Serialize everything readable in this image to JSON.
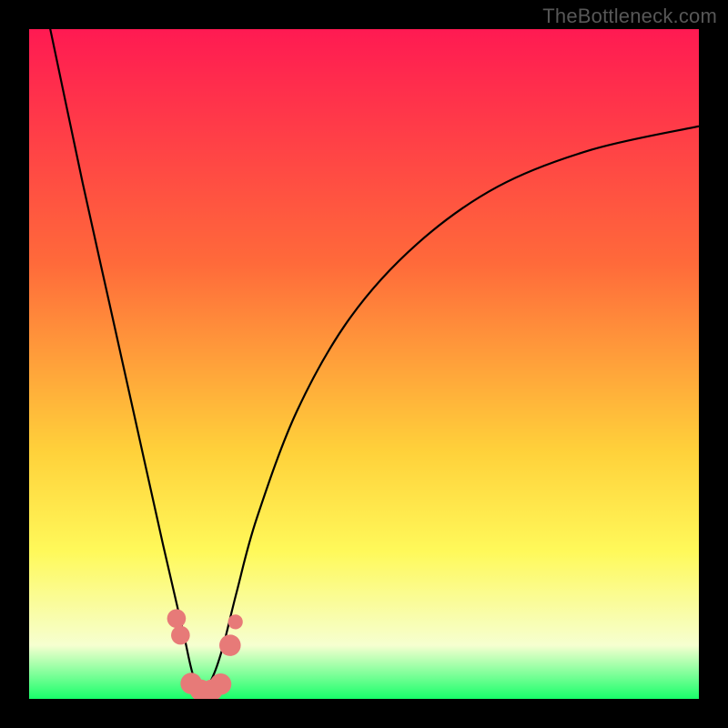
{
  "watermark": "TheBottleneck.com",
  "colors": {
    "frame": "#000000",
    "gradient_top": "#ff1a52",
    "gradient_mid1": "#ff6a3a",
    "gradient_mid2": "#ffd13a",
    "gradient_mid3": "#fff95a",
    "gradient_pale": "#f6ffd0",
    "gradient_bottom": "#18ff6a",
    "curve": "#000000",
    "marker": "#e77a78"
  },
  "chart_data": {
    "type": "line",
    "title": "",
    "xlabel": "",
    "ylabel": "",
    "xlim": [
      0,
      100
    ],
    "ylim": [
      0,
      100
    ],
    "x_min_point": 26,
    "series": [
      {
        "name": "bottleneck-curve",
        "x": [
          0,
          4,
          8,
          12,
          16,
          20,
          23,
          24.5,
          26,
          27.5,
          29,
          31,
          34,
          40,
          48,
          58,
          70,
          84,
          100
        ],
        "values": [
          115,
          96,
          77,
          59,
          41,
          23,
          10,
          3.5,
          1.2,
          3.5,
          8,
          16,
          27,
          43,
          57,
          68,
          76.5,
          82,
          85.5
        ]
      }
    ],
    "markers": [
      {
        "x": 22.0,
        "y": 12.0,
        "r": 1.4
      },
      {
        "x": 22.6,
        "y": 9.5,
        "r": 1.4
      },
      {
        "x": 24.2,
        "y": 2.3,
        "r": 1.6
      },
      {
        "x": 25.6,
        "y": 1.3,
        "r": 1.6
      },
      {
        "x": 27.3,
        "y": 1.3,
        "r": 1.6
      },
      {
        "x": 28.6,
        "y": 2.2,
        "r": 1.6
      },
      {
        "x": 30.0,
        "y": 8.0,
        "r": 1.6
      },
      {
        "x": 30.8,
        "y": 11.5,
        "r": 1.1
      }
    ]
  }
}
